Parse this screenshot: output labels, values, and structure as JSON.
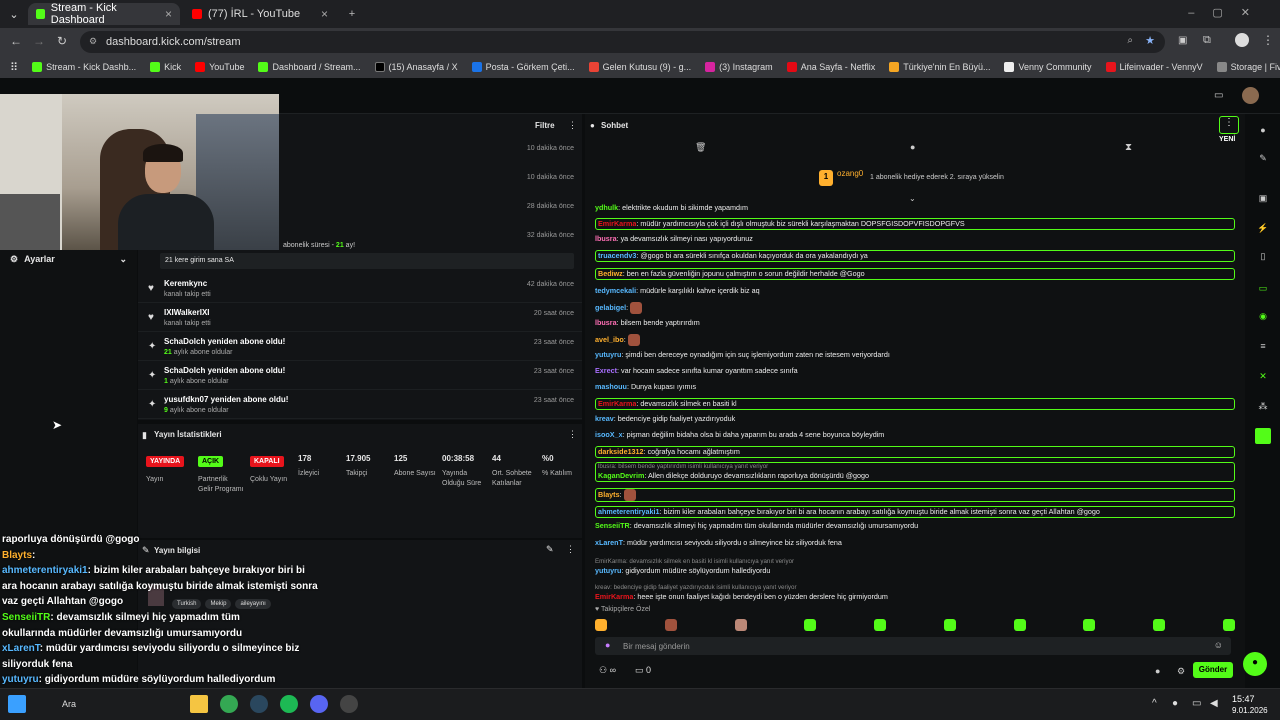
{
  "browser": {
    "tabs": [
      {
        "label": "Stream - Kick Dashboard",
        "active": true
      },
      {
        "label": "(77) İRL - YouTube",
        "active": false
      }
    ],
    "url": "dashboard.kick.com/stream",
    "bookmarks": [
      "Stream - Kick Dashb...",
      "Kick",
      "YouTube",
      "Dashboard / Stream...",
      "(15) Anasayfa / X",
      "Posta - Görkem Çeti...",
      "Gelen Kutusu (9) - g...",
      "(3) Instagram",
      "Ana Sayfa - Netflix",
      "Türkiye'nin En Büyü...",
      "Venny Community",
      "Lifeinvader - VennyV",
      "Storage | Fivemanage"
    ]
  },
  "left": {
    "settings_label": "Ayarlar"
  },
  "activity": {
    "filter_label": "Filtre",
    "partial_times": [
      "10 dakika önce",
      "10 dakika önce",
      "28 dakika önce",
      "32 dakika önce"
    ],
    "partial_text": "abonelik süresi -",
    "partial_months": "21",
    "partial_suffix": "ay!",
    "sa_text": "21 kere girim sana SA",
    "events": [
      {
        "name": "Keremkync",
        "sub": "kanalı takip etti",
        "time": "42 dakika önce",
        "icon": "heart"
      },
      {
        "name": "IXIWalkerIXI",
        "sub": "kanalı takip etti",
        "time": "20 saat önce",
        "icon": "heart"
      },
      {
        "name": "SchaDolch yeniden abone oldu!",
        "count": "21",
        "sub": "aylık abone oldular",
        "time": "23 saat önce",
        "icon": "star"
      },
      {
        "name": "SchaDolch yeniden abone oldu!",
        "count": "1",
        "sub": "aylık abone oldular",
        "time": "23 saat önce",
        "icon": "star"
      },
      {
        "name": "yusufdkn07 yeniden abone oldu!",
        "count": "9",
        "sub": "aylık abone oldular",
        "time": "23 saat önce",
        "icon": "star"
      }
    ]
  },
  "stats": {
    "title": "Yayın İstatistikleri",
    "items": [
      {
        "badge": "YAYINDA",
        "badge_color": "#e8141c",
        "label": "Yayın"
      },
      {
        "badge": "AÇIK",
        "badge_color": "#53fc18",
        "label": "Partnerlik Gelir Programı"
      },
      {
        "badge": "KAPALI",
        "badge_color": "#e8141c",
        "label": "Çoklu Yayın"
      },
      {
        "value": "178",
        "label": "İzleyici"
      },
      {
        "value": "17.905",
        "label": "Takipçi"
      },
      {
        "value": "125",
        "label": "Abone Sayısı"
      },
      {
        "value": "00:38:58",
        "label": "Yayında Olduğu Süre"
      },
      {
        "value": "44",
        "label": "Ort. Sohbete Katılanlar"
      },
      {
        "value": "%0",
        "label": "% Katılım"
      }
    ]
  },
  "info": {
    "title": "Yayın bilgisi",
    "tags": [
      "Turkish",
      "Mekip",
      "aileyayını"
    ]
  },
  "chat": {
    "title": "Sohbet",
    "new_label": "YENİ",
    "gift_user": "ozang0",
    "gift_count": "1",
    "gift_text": "1 abonelik hediye ederek 2. sıraya yükselin",
    "placeholder": "Bir mesaj gönderin",
    "send_label": "Gönder",
    "followers_label": "Takipçilere Özel",
    "points": "∞",
    "counter": "0",
    "messages": [
      {
        "user": "ydhulk",
        "color": "#53fc18",
        "text": "elektrikte okudum bi sikimde yapamdım",
        "hl": false
      },
      {
        "user": "EmirKarma",
        "color": "#e8141c",
        "text": "müdür yardımcısıyla çok içli dışlı olmuştuk biz sürekli karşılaşmaktan DOPSFGISDOPVFISDOPGFVS",
        "hl": true
      },
      {
        "user": "lbusra",
        "color": "#ff6fb5",
        "text": "ya devamsızlık silmeyi nası yapıyordunuz",
        "hl": false
      },
      {
        "user": "truacendv3",
        "color": "#58b9ff",
        "text": "@gogo bi ara sürekli sınıfça okuldan kaçıyorduk da ora yakalandıydı ya",
        "hl": true
      },
      {
        "user": "Bediwz",
        "color": "#ffb02e",
        "text": "ben en fazla güvenliğin jopunu çalmıştım o sorun değildir herhalde @Gogo",
        "hl": true
      },
      {
        "user": "tedymcekali",
        "color": "#58b9ff",
        "text": "müdürle karşılıklı kahve içerdik biz aq",
        "hl": false
      },
      {
        "user": "gelabigel",
        "color": "#58b9ff",
        "text": "",
        "hl": false
      },
      {
        "user": "lbusra",
        "color": "#ff6fb5",
        "text": "bilsem bende yaptırırdım",
        "hl": false
      },
      {
        "user": "avel_ibo",
        "color": "#ffb02e",
        "text": "",
        "hl": false
      },
      {
        "user": "yutuyru",
        "color": "#58b9ff",
        "text": "şimdi ben dereceye oynadığım için suç işlemiyordum zaten ne istesem veriyordardı",
        "hl": false
      },
      {
        "user": "Exrect",
        "color": "#a970ff",
        "text": "var hocam sadece sınıfta kumar oyanttım sadece sınıfa",
        "hl": false
      },
      {
        "user": "mashouu",
        "color": "#58b9ff",
        "text": "Dunya kupası ıyımıs",
        "hl": false
      },
      {
        "user": "EmirKarma",
        "color": "#e8141c",
        "text": "devamsızlık silmek en basiti kl",
        "hl": true
      },
      {
        "user": "kreav",
        "color": "#58b9ff",
        "text": "bedenciye gidip faaliyet yazdırıyoduk",
        "hl": false
      },
      {
        "user": "isooX_x",
        "color": "#58b9ff",
        "text": "pişman değilim bidaha olsa bi daha yaparım bu arada 4 sene boyunca böyleydim",
        "hl": false
      },
      {
        "user": "darkside1312",
        "color": "#ffb02e",
        "text": "coğrafya hocamı ağlatmıştım",
        "hl": true
      },
      {
        "user": "KaganDevrim",
        "color": "#53fc18",
        "reply": "lbusra: bilsem bende yaptırırdım isimli kullanıcıya yanıt veriyor",
        "text": "Allen dilekçe dolduruyo devamsızlıkların raporluya dönüşürdü @gogo",
        "hl": true
      },
      {
        "user": "Blayts",
        "color": "#ffb02e",
        "text": "",
        "hl": true
      },
      {
        "user": "ahmeterentiryaki1",
        "color": "#58b9ff",
        "text": "bizim kiler arabaları bahçeye bırakıyor biri bi ara hocanın arabayı satılığa koymuştu biride almak istemişti sonra vaz geçti Allahtan @gogo",
        "hl": true
      },
      {
        "user": "SenseiiTR",
        "color": "#53fc18",
        "text": "devamsızlık silmeyi hiç yapmadım tüm okullarında müdürler devamsızlığı umursamıyordu",
        "hl": false
      },
      {
        "user": "xLarenT",
        "color": "#58b9ff",
        "text": "müdür yardımcısı seviyodu siliyordu o silmeyince biz siliyorduk fena",
        "hl": false
      },
      {
        "user": "yutuyru",
        "color": "#58b9ff",
        "reply": "EmirKarma: devamsızlık silmek en basiti kl isimli kullanıcıya yanıt veriyor",
        "text": "gidiyordum müdüre söylüyordum hallediyordu",
        "hl": false
      },
      {
        "user": "EmirKarma",
        "color": "#e8141c",
        "reply": "kreav: bedenciye gidip faaliyet yazdırıyoduk isimli kullanıcıya yanıt veriyor",
        "text": "heee işte onun faaliyet kağıdı bendeydi ben o yüzden derslere hiç girmiyordum",
        "hl": false
      }
    ]
  },
  "overlay": {
    "lines": [
      {
        "user": "",
        "text": "raporluya dönüşürdü @gogo"
      },
      {
        "user": "Blayts",
        "text": ":"
      },
      {
        "user": "ahmeterentiryaki1",
        "text": ": bizim kiler arabaları bahçeye bırakıyor biri bi"
      },
      {
        "user": "",
        "text": "ara hocanın arabayı satılığa koymuştu biride almak istemişti sonra"
      },
      {
        "user": "",
        "text": "vaz geçti Allahtan @gogo"
      },
      {
        "user": "SenseiiTR",
        "text": ": devamsızlık silmeyi hiç yapmadım tüm"
      },
      {
        "user": "",
        "text": "okullarında müdürler devamsızlığı umursamıyordu"
      },
      {
        "user": "xLarenT",
        "text": ": müdür yardımcısı seviyodu siliyordu o silmeyince biz"
      },
      {
        "user": "",
        "text": "siliyorduk fena"
      },
      {
        "user": "yutuyru",
        "text": ": gidiyordum müdüre söylüyordum hallediyordum"
      },
      {
        "user": "EmirKarma",
        "text": ": heee işte onun faaliyet kağıdı bendeydi ben o"
      },
      {
        "user": "",
        "text": "yüzden derslere hiç girmiyordum"
      }
    ]
  },
  "taskbar": {
    "time": "15:47",
    "date": "9.01.2026",
    "search": "Ara"
  },
  "colors": {
    "accent": "#53fc18",
    "live": "#e8141c",
    "bg": "#0b0d0e"
  }
}
